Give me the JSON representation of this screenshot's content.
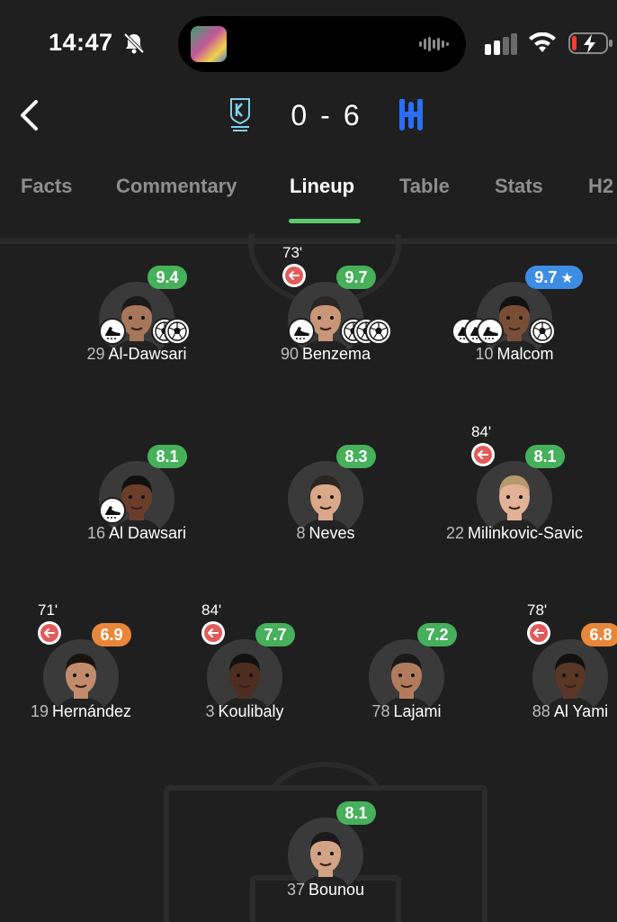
{
  "status_bar": {
    "time": "14:47"
  },
  "match": {
    "home_score": "0",
    "separator": "-",
    "away_score": "6"
  },
  "tabs": [
    {
      "label": "Facts",
      "active": false
    },
    {
      "label": "Commentary",
      "active": false
    },
    {
      "label": "Lineup",
      "active": true
    },
    {
      "label": "Table",
      "active": false
    },
    {
      "label": "Stats",
      "active": false
    },
    {
      "label": "H2",
      "active": false
    }
  ],
  "colors": {
    "background": "#1f1f1f",
    "rating_green": "#46b05a",
    "rating_orange": "#e8873a",
    "rating_blue": "#3e8de4",
    "substitution": "#e25b5b",
    "tab_indicator": "#5ccb6e"
  },
  "players": [
    {
      "number": "29",
      "name": "Al-Dawsari",
      "rating": "9.4",
      "rating_color": "green",
      "sub_time": "",
      "assists": 1,
      "goals": 2
    },
    {
      "number": "90",
      "name": "Benzema",
      "rating": "9.7",
      "rating_color": "green",
      "sub_time": "73'",
      "assists": 1,
      "goals": 3
    },
    {
      "number": "10",
      "name": "Malcom",
      "rating": "9.7",
      "rating_color": "blue",
      "sub_time": "",
      "assists": 3,
      "goals": 1
    },
    {
      "number": "16",
      "name": "Al Dawsari",
      "rating": "8.1",
      "rating_color": "green",
      "sub_time": "",
      "assists": 1,
      "goals": 0
    },
    {
      "number": "8",
      "name": "Neves",
      "rating": "8.3",
      "rating_color": "green",
      "sub_time": "",
      "assists": 0,
      "goals": 0
    },
    {
      "number": "22",
      "name": "Milinkovic-Savic",
      "rating": "8.1",
      "rating_color": "green",
      "sub_time": "84'",
      "assists": 0,
      "goals": 0
    },
    {
      "number": "19",
      "name": "Hernández",
      "rating": "6.9",
      "rating_color": "orange",
      "sub_time": "71'",
      "assists": 0,
      "goals": 0
    },
    {
      "number": "3",
      "name": "Koulibaly",
      "rating": "7.7",
      "rating_color": "green",
      "sub_time": "84'",
      "assists": 0,
      "goals": 0
    },
    {
      "number": "78",
      "name": "Lajami",
      "rating": "7.2",
      "rating_color": "green",
      "sub_time": "",
      "assists": 0,
      "goals": 0
    },
    {
      "number": "88",
      "name": "Al Yami",
      "rating": "6.8",
      "rating_color": "orange",
      "sub_time": "78'",
      "assists": 0,
      "goals": 0
    },
    {
      "number": "37",
      "name": "Bounou",
      "rating": "8.1",
      "rating_color": "green",
      "sub_time": "",
      "assists": 0,
      "goals": 0
    }
  ],
  "icons": {
    "back": "chevron-left-icon",
    "substitution": "arrow-left-icon",
    "goal": "football-icon",
    "assist": "boot-icon",
    "man_of_the_match": "star-icon",
    "mute": "bell-slash-icon"
  }
}
